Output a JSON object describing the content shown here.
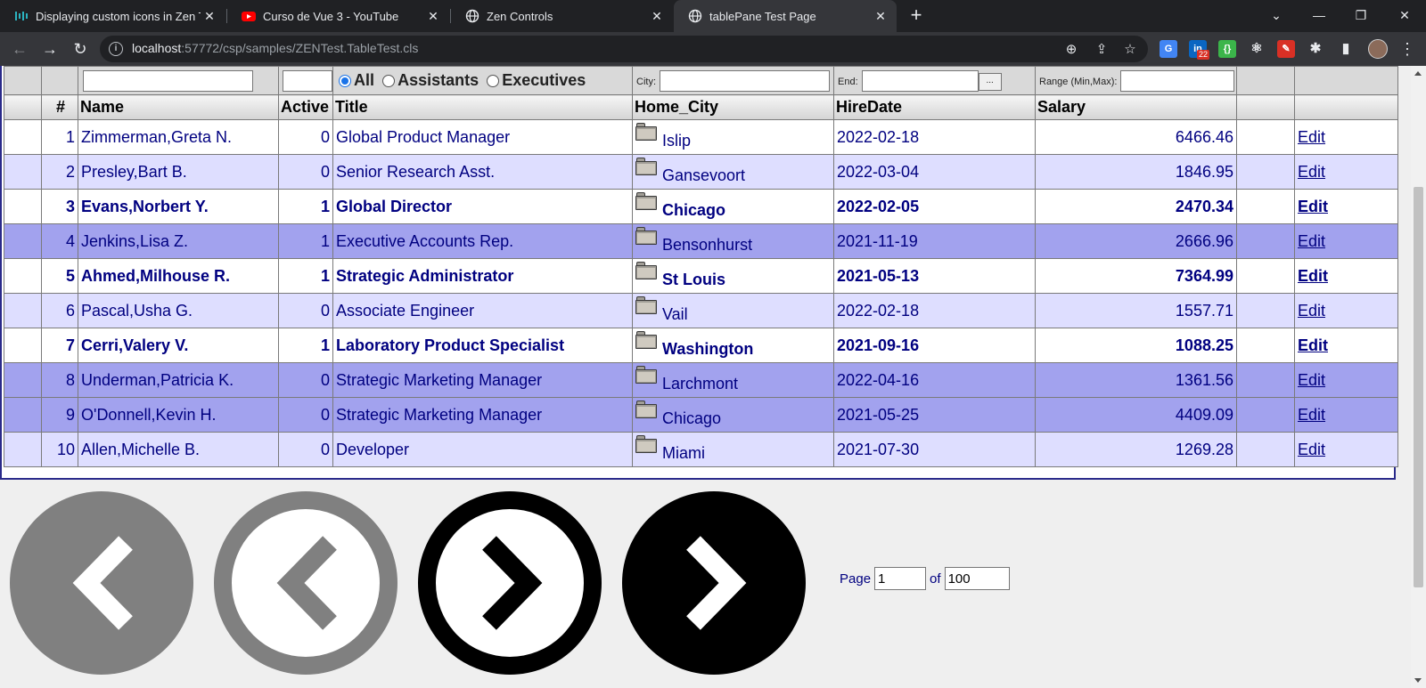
{
  "browser": {
    "tabs": [
      {
        "title": "Displaying custom icons in Zen Ta",
        "active": false
      },
      {
        "title": "Curso de Vue 3 - YouTube",
        "active": false
      },
      {
        "title": "Zen Controls",
        "active": false
      },
      {
        "title": "tablePane Test Page",
        "active": true
      }
    ],
    "new_tab": "+",
    "address": {
      "host": "localhost",
      "rest": ":57772/csp/samples/ZENTest.TableTest.cls"
    },
    "extension_badge": "22"
  },
  "filters": {
    "radio_options": [
      "All",
      "Assistants",
      "Executives"
    ],
    "radio_selected": "All",
    "city_label": "City:",
    "end_label": "End:",
    "end_button": "...",
    "range_label": "Range (Min,Max):"
  },
  "columns": [
    "#",
    "Name",
    "Active",
    "Title",
    "Home_City",
    "HireDate",
    "Salary",
    "",
    ""
  ],
  "rows": [
    {
      "num": "1",
      "name": "Zimmerman,Greta N.",
      "active": "0",
      "title": "Global Product Manager",
      "city": "Islip",
      "hire": "2022-02-18",
      "salary": "6466.46",
      "edit": "Edit",
      "style": "even",
      "bold": false
    },
    {
      "num": "2",
      "name": "Presley,Bart B.",
      "active": "0",
      "title": "Senior Research Asst.",
      "city": "Gansevoort",
      "hire": "2022-03-04",
      "salary": "1846.95",
      "edit": "Edit",
      "style": "odd",
      "bold": false
    },
    {
      "num": "3",
      "name": "Evans,Norbert Y.",
      "active": "1",
      "title": "Global Director",
      "city": "Chicago",
      "hire": "2022-02-05",
      "salary": "2470.34",
      "edit": "Edit",
      "style": "even",
      "bold": true
    },
    {
      "num": "4",
      "name": "Jenkins,Lisa Z.",
      "active": "1",
      "title": "Executive Accounts Rep.",
      "city": "Bensonhurst",
      "hire": "2021-11-19",
      "salary": "2666.96",
      "edit": "Edit",
      "style": "sel",
      "bold": false
    },
    {
      "num": "5",
      "name": "Ahmed,Milhouse R.",
      "active": "1",
      "title": "Strategic Administrator",
      "city": "St Louis",
      "hire": "2021-05-13",
      "salary": "7364.99",
      "edit": "Edit",
      "style": "even",
      "bold": true
    },
    {
      "num": "6",
      "name": "Pascal,Usha G.",
      "active": "0",
      "title": "Associate Engineer",
      "city": "Vail",
      "hire": "2022-02-18",
      "salary": "1557.71",
      "edit": "Edit",
      "style": "odd",
      "bold": false
    },
    {
      "num": "7",
      "name": "Cerri,Valery V.",
      "active": "1",
      "title": "Laboratory Product Specialist",
      "city": "Washington",
      "hire": "2021-09-16",
      "salary": "1088.25",
      "edit": "Edit",
      "style": "even",
      "bold": true
    },
    {
      "num": "8",
      "name": "Underman,Patricia K.",
      "active": "0",
      "title": "Strategic Marketing Manager",
      "city": "Larchmont",
      "hire": "2022-04-16",
      "salary": "1361.56",
      "edit": "Edit",
      "style": "sel",
      "bold": false
    },
    {
      "num": "9",
      "name": "O'Donnell,Kevin H.",
      "active": "0",
      "title": "Strategic Marketing Manager",
      "city": "Chicago",
      "hire": "2021-05-25",
      "salary": "4409.09",
      "edit": "Edit",
      "style": "sel",
      "bold": false
    },
    {
      "num": "10",
      "name": "Allen,Michelle B.",
      "active": "0",
      "title": "Developer",
      "city": "Miami",
      "hire": "2021-07-30",
      "salary": "1269.28",
      "edit": "Edit",
      "style": "odd",
      "bold": false
    }
  ],
  "pager": {
    "buttons": [
      "first-page-icon",
      "previous-page-icon",
      "next-page-icon",
      "last-page-icon"
    ],
    "page_label": "Page",
    "page_value": "1",
    "of_label": "of",
    "total_value": "100"
  },
  "colors": {
    "link": "#000080",
    "selected_row": "#a2a2ee",
    "odd_row": "#dedeff"
  }
}
